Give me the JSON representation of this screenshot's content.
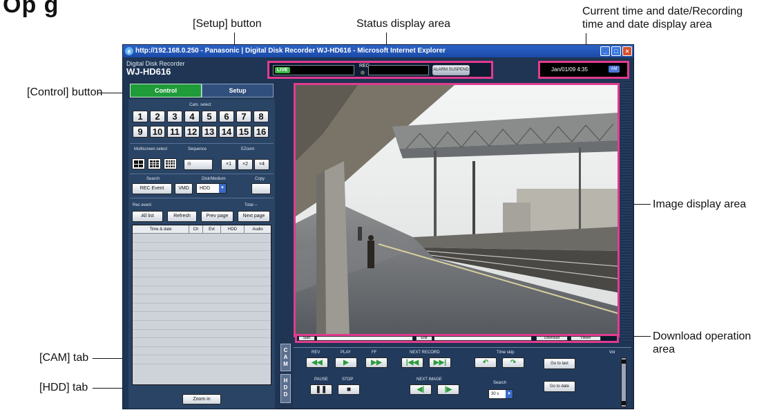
{
  "heading_fragment": "Op      g",
  "callouts": {
    "setup": "[Setup] button",
    "status": "Status display area",
    "time_line1": "Current time and date/Recording",
    "time_line2": "time and date display area",
    "control": "[Control] button",
    "image": "Image display area",
    "download_line1": "Download operation",
    "download_line2": "area",
    "cam_tab": "[CAM] tab",
    "hdd_tab": "[HDD] tab"
  },
  "browser": {
    "title": "http://192.168.0.250 - Panasonic | Digital Disk Recorder WJ-HD616 - Microsoft Internet Explorer",
    "icon": "ie-icon",
    "controls": [
      "_",
      "□",
      "×"
    ]
  },
  "product": {
    "line1": "Digital Disk Recorder",
    "line2": "WJ-HD616"
  },
  "status": {
    "live": "LIVE",
    "rec": "REC",
    "alarm_btn": "ALARM SUSPEND"
  },
  "time": {
    "text": "Jan/01/09  4:35",
    "badge": "AM"
  },
  "tabs": {
    "control": "Control",
    "setup": "Setup"
  },
  "cam_select": {
    "label": "Cam. select",
    "numbers": [
      "1",
      "2",
      "3",
      "4",
      "5",
      "6",
      "7",
      "8",
      "9",
      "10",
      "11",
      "12",
      "13",
      "14",
      "15",
      "16"
    ]
  },
  "multiscreen": {
    "label": "Multiscreen select"
  },
  "sequence": {
    "label": "Sequence",
    "btn": "⊙"
  },
  "ezoom": {
    "label": "EZoom",
    "options": [
      "×1",
      "×2",
      "×4"
    ]
  },
  "search": {
    "label": "Search",
    "rec_event": "REC Event",
    "vmd": "VMD"
  },
  "disk": {
    "label": "Disk/Medium",
    "value": "HDD"
  },
  "copy": {
    "label": "Copy"
  },
  "rec_event": {
    "label": "Rec event",
    "total": "Total --",
    "buttons": [
      "All list",
      "Refresh",
      "Prev page",
      "Next page"
    ]
  },
  "event_table": {
    "headers": [
      "Time & date",
      "Ch",
      "Evt",
      "HDD",
      "Audio"
    ],
    "rows": 15
  },
  "zoom_in": "Zoom in",
  "vtabs": {
    "cam": "CAM",
    "hdd": "HDD"
  },
  "download": {
    "start": "Start",
    "end": "End",
    "download": "Download",
    "viewer": "Viewer"
  },
  "playback": {
    "labels": {
      "rev": "REV",
      "play": "PLAY",
      "ff": "FF",
      "next_record": "NEXT RECORD",
      "time_skip": "Time skip",
      "pause": "PAUSE",
      "stop": "STOP",
      "next_image": "NEXT IMAGE",
      "search": "Search",
      "vol": "Vol"
    },
    "skip_value": "30 s",
    "go_last": "Go to last",
    "go_date": "Go to date"
  }
}
